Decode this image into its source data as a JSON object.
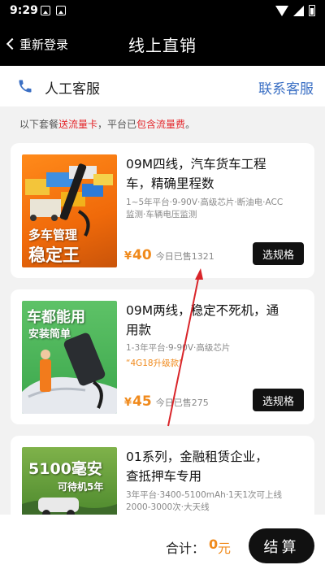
{
  "status_bar": {
    "time": "9:29"
  },
  "nav": {
    "back_label": "重新登录",
    "title": "线上直销"
  },
  "service": {
    "label": "人工客服",
    "contact_link": "联系客服"
  },
  "notice": {
    "prefix": "以下套餐",
    "highlight1": "送流量卡",
    "middle": "，平台已",
    "highlight2": "包含流量费",
    "suffix": "。"
  },
  "products": [
    {
      "title": "09M四线，汽车货车工程车，精确里程数",
      "subtitle": "1~5年平台·9-90V·高级芯片·断油电·ACC监测·车辆电压监测",
      "tag": "",
      "price_symbol": "¥",
      "price": "40",
      "sold": "今日已售1321",
      "button": "选规格",
      "thumb_line1": "多车管理",
      "thumb_line2": "稳定王"
    },
    {
      "title": "09M两线，稳定不死机，通用款",
      "subtitle": "1-3年平台·9-90V·高级芯片",
      "tag": "“4G18升级款”",
      "price_symbol": "¥",
      "price": "45",
      "sold": "今日已售275",
      "button": "选规格",
      "thumb_line1": "车都能用",
      "thumb_line2": "安装简单"
    },
    {
      "title": "01系列，金融租赁企业，查抵押车专用",
      "subtitle": "3年平台·3400-5100mAh·1天1次可上线2000-3000次·大天线",
      "tag": "",
      "thumb_line1": "5100毫安",
      "thumb_line2": "可待机5年"
    }
  ],
  "bottom": {
    "total_label": "合计：",
    "total_value": "0",
    "total_unit": "元",
    "checkout": "结算"
  },
  "colors": {
    "accent_orange": "#f08a1c",
    "link_blue": "#3a6fc4",
    "highlight_red": "#e4262b",
    "annotation_red": "#d9252a"
  }
}
